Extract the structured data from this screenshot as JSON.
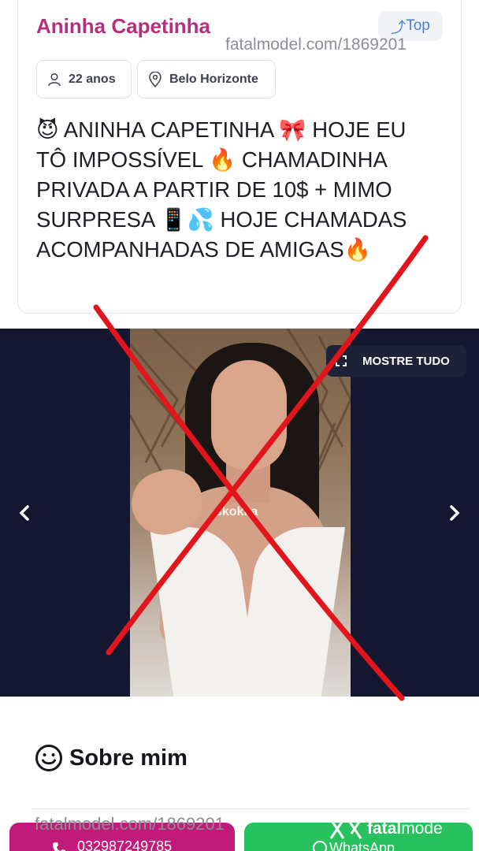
{
  "profile": {
    "name": "Aninha Capetinha",
    "top_badge": "Top",
    "watermark_url": "fatalmodel.com/1869201",
    "age": "22 anos",
    "city": "Belo Horizonte",
    "description": "😈 ANINHA CAPETINHA 🎀 HOJE EU TÔ IMPOSSÍVEL 🔥 CHAMADINHA PRIVADA A PARTIR DE 10$ + MIMO SURPRESA 📱💦 HOJE CHAMADAS ACOMPANHADAS DE AMIGAS🔥"
  },
  "gallery": {
    "show_all_label": "MOSTRE TUDO",
    "photo_watermark": "skokka"
  },
  "about": {
    "title": "Sobre mim"
  },
  "footer": {
    "watermark_url": "fatalmodel.com/1869201",
    "phone_label": "032987249785",
    "whatsapp_label": "WhatsApp",
    "brand_prefix": "fatal",
    "brand_suffix": "mode"
  },
  "colors": {
    "accent": "#b4307f",
    "phone_button": "#c11a7b",
    "whatsapp_button": "#27c15f",
    "gallery_bg": "#14172f",
    "overlay_x": "#e1151b"
  },
  "icons": [
    "person-icon",
    "location-pin-icon",
    "expand-icon",
    "chevron-left-icon",
    "chevron-right-icon",
    "smiley-icon",
    "phone-icon",
    "whatsapp-icon"
  ]
}
